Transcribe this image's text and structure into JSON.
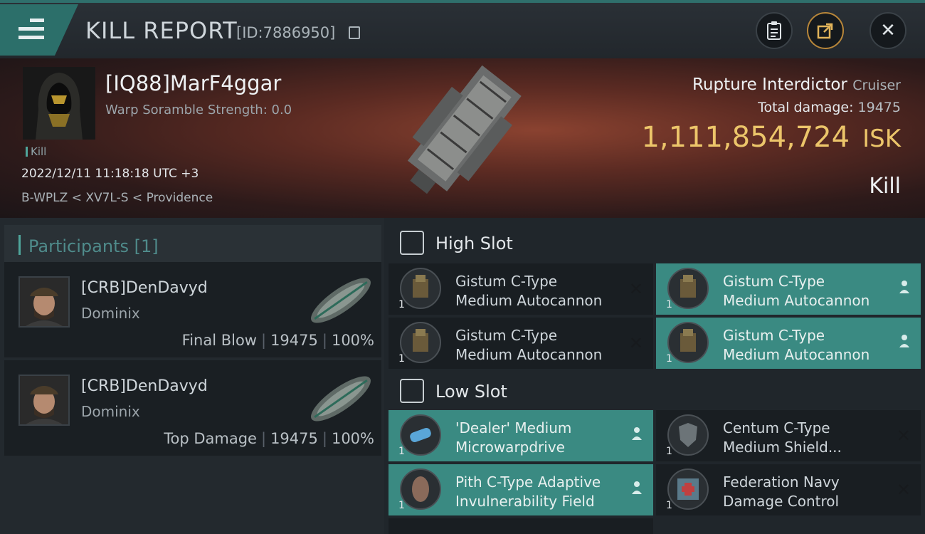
{
  "header": {
    "title": "KILL REPORT",
    "report_id": "[ID:7886950]"
  },
  "victim": {
    "name": "[IQ88]MarF4ggar",
    "warp_scramble": "Warp Soramble Strength: 0.0",
    "tag": "Kill",
    "datetime": "2022/12/11 11:18:18 UTC +3",
    "location": "B-WPLZ < XV7L-S < Providence",
    "ship": "Rupture Interdictor",
    "ship_class": "Cruiser",
    "total_damage_label": "Total damage:",
    "total_damage": "19475",
    "isk_value": "1,111,854,724",
    "isk_unit": "ISK",
    "result": "Kill"
  },
  "participants": {
    "title": "Participants [1]",
    "items": [
      {
        "name": "[CRB]DenDavyd",
        "ship": "Dominix",
        "role": "Final Blow",
        "damage": "19475",
        "percent": "100%"
      },
      {
        "name": "[CRB]DenDavyd",
        "ship": "Dominix",
        "role": "Top Damage",
        "damage": "19475",
        "percent": "100%"
      }
    ]
  },
  "slots": {
    "high": {
      "label": "High Slot",
      "modules": [
        {
          "line1": "Gistum C-Type",
          "line2": "Medium Autocannon",
          "qty": "1",
          "status": "destroyed"
        },
        {
          "line1": "Gistum C-Type",
          "line2": "Medium Autocannon",
          "qty": "1",
          "status": "dropped"
        },
        {
          "line1": "Gistum C-Type",
          "line2": "Medium Autocannon",
          "qty": "1",
          "status": "destroyed"
        },
        {
          "line1": "Gistum C-Type",
          "line2": "Medium Autocannon",
          "qty": "1",
          "status": "dropped"
        }
      ]
    },
    "low": {
      "label": "Low Slot",
      "modules": [
        {
          "line1": "'Dealer' Medium",
          "line2": "Microwarpdrive",
          "qty": "1",
          "status": "dropped"
        },
        {
          "line1": "Centum C-Type",
          "line2": "Medium Shield...",
          "qty": "1",
          "status": "destroyed"
        },
        {
          "line1": "Pith C-Type Adaptive",
          "line2": "Invulnerability Field",
          "qty": "1",
          "status": "dropped"
        },
        {
          "line1": "Federation Navy",
          "line2": "Damage Control",
          "qty": "1",
          "status": "destroyed"
        }
      ]
    }
  },
  "colors": {
    "accent_teal": "#3a8a82",
    "isk_gold": "#ecc56a",
    "share_orange": "#b9873a"
  }
}
